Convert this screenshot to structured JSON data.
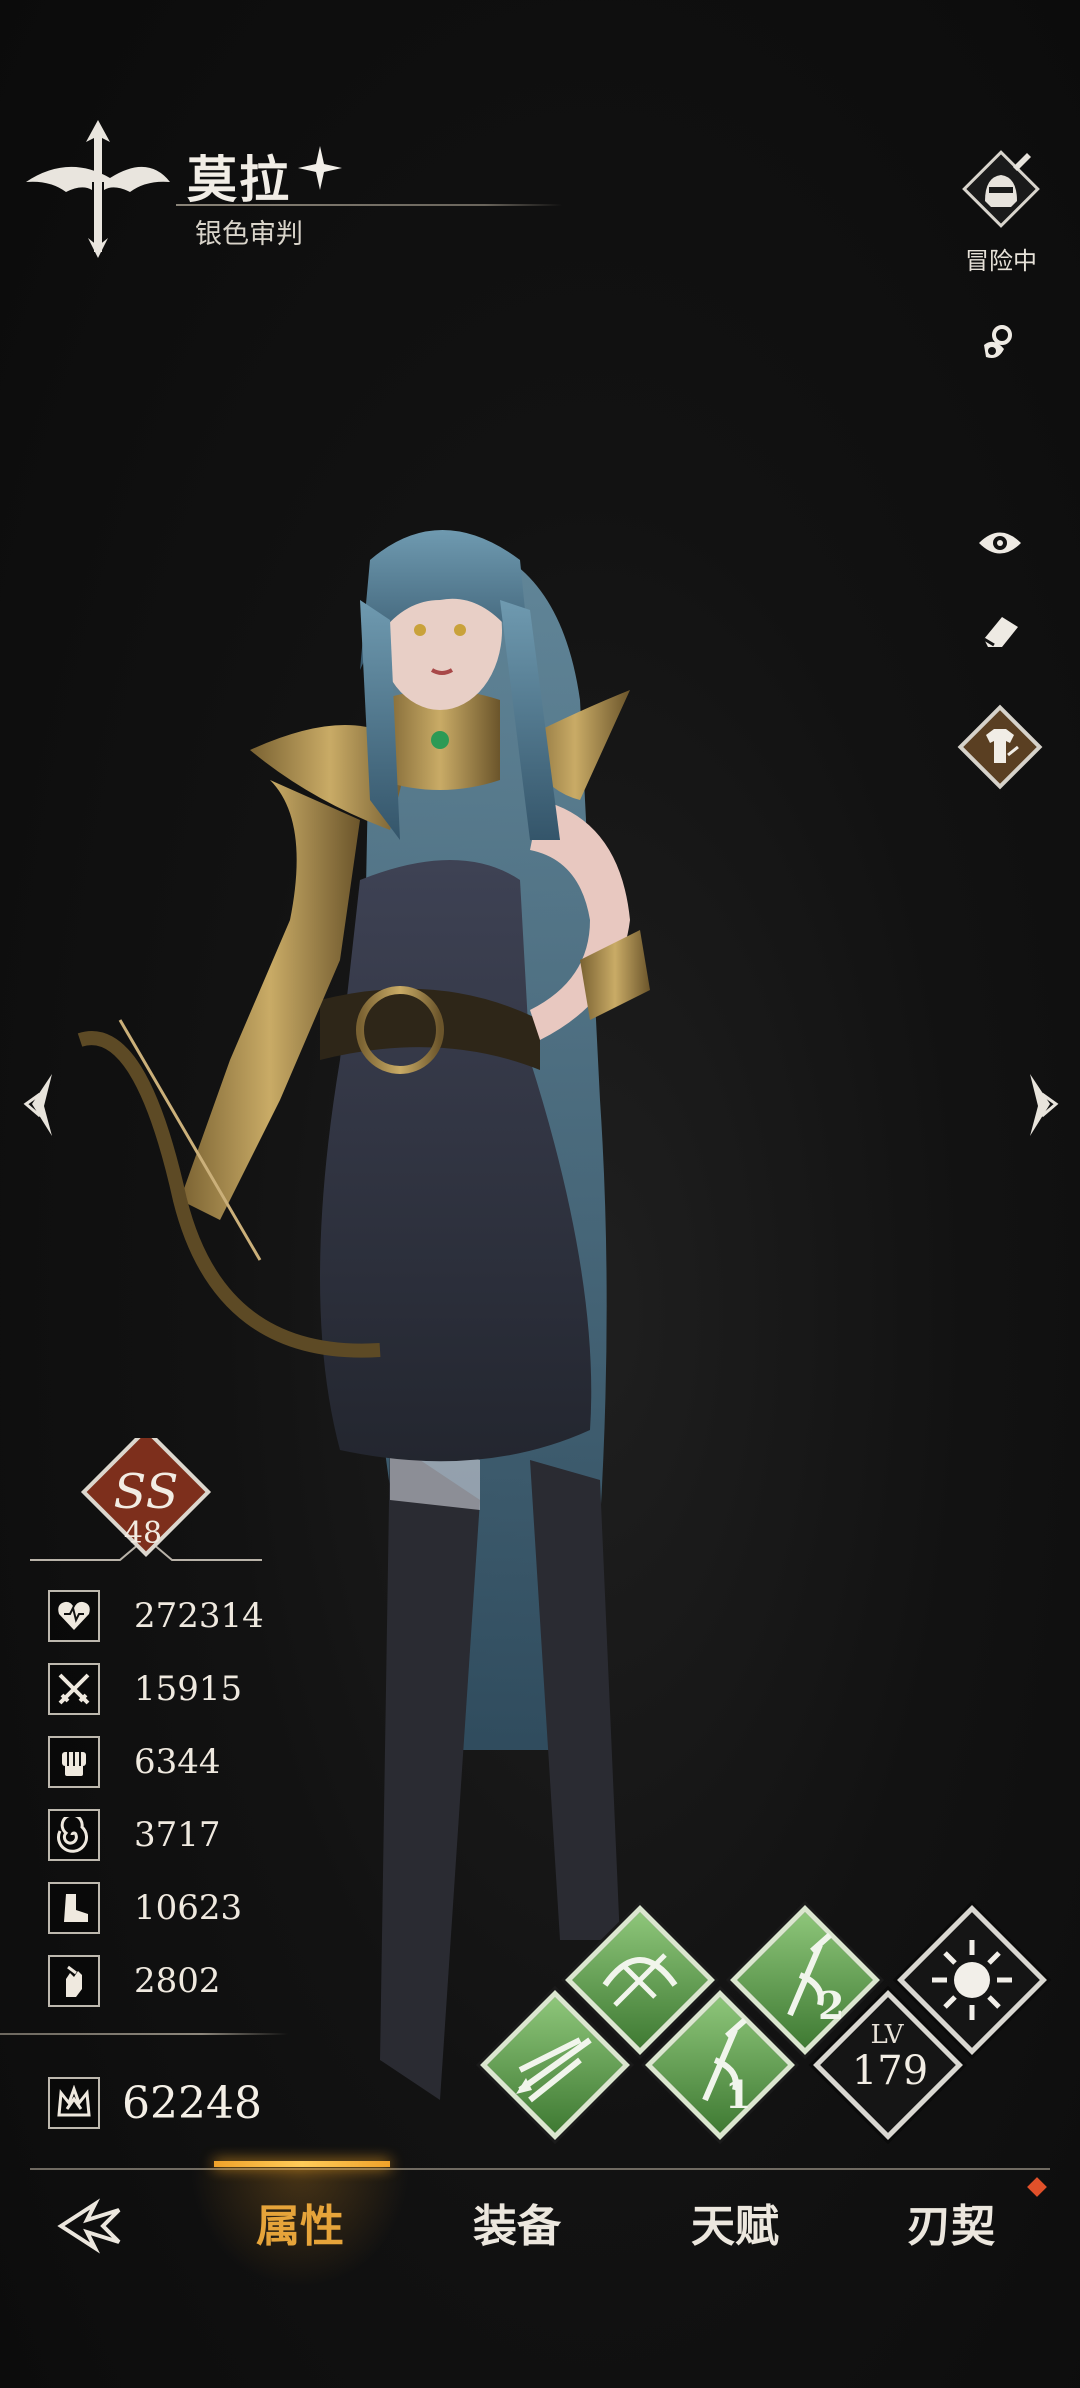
{
  "header": {
    "character_name": "莫拉",
    "character_title": "银色审判",
    "class_icon": "bow-icon",
    "star_icon": "four-point-star-icon"
  },
  "right_panel": {
    "status_label": "冒险中",
    "status_icon": "knight-helmet-sword-icon",
    "icons": [
      "pacifier-icon",
      "eye-icon",
      "eraser-icon",
      "outfit-icon"
    ]
  },
  "rank": {
    "grade": "SS",
    "level": "48"
  },
  "stats": [
    {
      "icon": "heart-icon",
      "value": "272314"
    },
    {
      "icon": "crossed-swords-icon",
      "value": "15915"
    },
    {
      "icon": "fist-icon",
      "value": "6344"
    },
    {
      "icon": "swirl-icon",
      "value": "3717"
    },
    {
      "icon": "boot-icon",
      "value": "10623"
    },
    {
      "icon": "hand-icon",
      "value": "2802"
    }
  ],
  "combat_power": {
    "icon": "crown-icon",
    "value": "62248"
  },
  "skills": {
    "level_label": "LV",
    "level_value": "179",
    "skill_badges": [
      "2",
      "1"
    ]
  },
  "bottom_nav": {
    "tabs": [
      "属性",
      "装备",
      "天赋",
      "刃契"
    ],
    "active_tab": 0,
    "accent_color": "#e6a43a",
    "badge_color": "#e0512a"
  }
}
